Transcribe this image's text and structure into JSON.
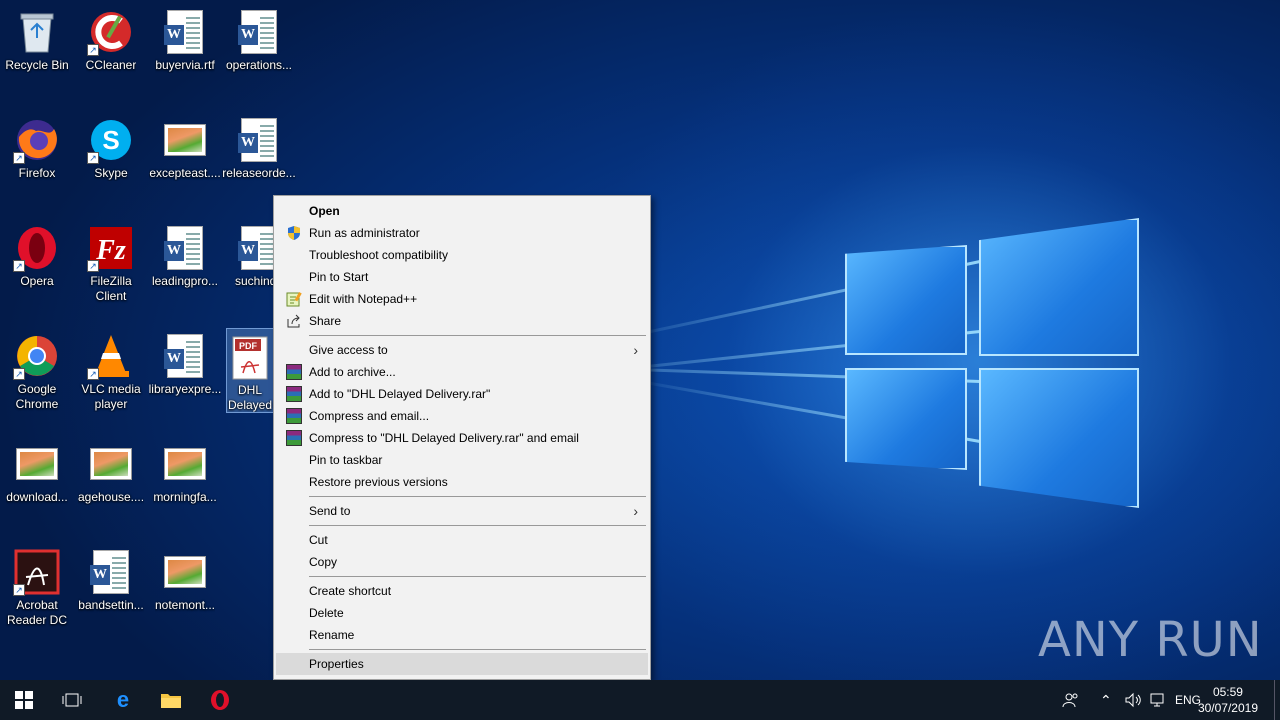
{
  "desktop_icons": [
    {
      "label": "Recycle Bin"
    },
    {
      "label": "CCleaner"
    },
    {
      "label": "buyervia.rtf"
    },
    {
      "label": "operations..."
    },
    {
      "label": "Firefox"
    },
    {
      "label": "Skype"
    },
    {
      "label": "excepteast...."
    },
    {
      "label": "releaseorde..."
    },
    {
      "label": "Opera"
    },
    {
      "label": "FileZilla Client"
    },
    {
      "label": "leadingpro..."
    },
    {
      "label": "suchindu"
    },
    {
      "label": "Google Chrome"
    },
    {
      "label": "VLC media player"
    },
    {
      "label": "libraryexpre..."
    },
    {
      "label": "DHL Delayed Delivery"
    },
    {
      "label": "download..."
    },
    {
      "label": "agehouse...."
    },
    {
      "label": "morningfa..."
    },
    {
      "label": "Acrobat Reader DC"
    },
    {
      "label": "bandsettin..."
    },
    {
      "label": "notemont..."
    }
  ],
  "context_menu": {
    "items": [
      {
        "label": "Open"
      },
      {
        "label": "Run as administrator"
      },
      {
        "label": "Troubleshoot compatibility"
      },
      {
        "label": "Pin to Start"
      },
      {
        "label": "Edit with Notepad++"
      },
      {
        "label": "Share"
      },
      {
        "label": "Give access to"
      },
      {
        "label": "Add to archive..."
      },
      {
        "label": "Add to \"DHL Delayed Delivery.rar\""
      },
      {
        "label": "Compress and email..."
      },
      {
        "label": "Compress to \"DHL Delayed Delivery.rar\" and email"
      },
      {
        "label": "Pin to taskbar"
      },
      {
        "label": "Restore previous versions"
      },
      {
        "label": "Send to"
      },
      {
        "label": "Cut"
      },
      {
        "label": "Copy"
      },
      {
        "label": "Create shortcut"
      },
      {
        "label": "Delete"
      },
      {
        "label": "Rename"
      },
      {
        "label": "Properties"
      }
    ]
  },
  "taskbar": {
    "language": "ENG",
    "time": "05:59",
    "date": "30/07/2019"
  },
  "watermark": "ANY RUN"
}
